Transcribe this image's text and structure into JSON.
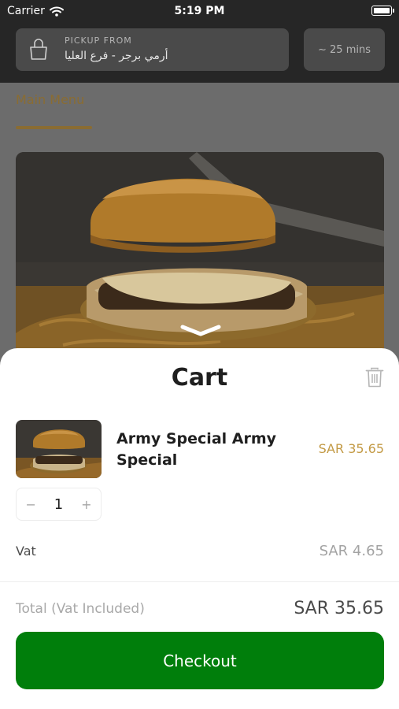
{
  "status_bar": {
    "carrier": "Carrier",
    "time": "5:19 PM"
  },
  "header": {
    "pickup_label": "PICKUP FROM",
    "pickup_branch": "أرمي برجر - فرع العليا",
    "eta": "~ 25 mins",
    "icon": "shopping-bag-icon"
  },
  "menu": {
    "tab": "Main Menu"
  },
  "cart": {
    "title": "Cart",
    "items": [
      {
        "name": "Army Special Army Special",
        "price": "SAR 35.65",
        "quantity": "1"
      }
    ],
    "vat_label": "Vat",
    "vat_value": "SAR 4.65",
    "total_label": "Total",
    "total_note": "(Vat Included)",
    "total_value": "SAR 35.65",
    "checkout_label": "Checkout"
  },
  "colors": {
    "accent": "#c39a45",
    "checkout": "#007e0b"
  }
}
